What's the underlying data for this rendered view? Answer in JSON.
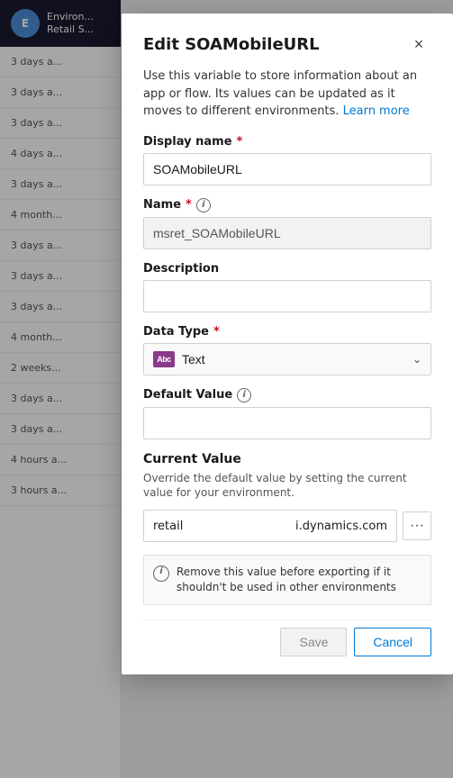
{
  "background": {
    "header": {
      "org_abbr": "E",
      "line1": "Environ...",
      "line2": "Retail S..."
    },
    "list_items": [
      {
        "age": "3 days a..."
      },
      {
        "age": "3 days a..."
      },
      {
        "age": "3 days a..."
      },
      {
        "age": "4 days a..."
      },
      {
        "age": "3 days a..."
      },
      {
        "age": "4 month..."
      },
      {
        "age": "3 days a..."
      },
      {
        "age": "3 days a..."
      },
      {
        "age": "3 days a..."
      },
      {
        "age": "4 month..."
      },
      {
        "age": "2 weeks..."
      },
      {
        "age": "3 days a..."
      },
      {
        "age": "3 days a..."
      },
      {
        "age": "4 hours a..."
      },
      {
        "age": "3 hours a..."
      }
    ]
  },
  "modal": {
    "title": "Edit SOAMobileURL",
    "close_label": "×",
    "description": "Use this variable to store information about an app or flow. Its values can be updated as it moves to different environments.",
    "learn_more": "Learn more",
    "display_name": {
      "label": "Display name",
      "required": true,
      "value": "SOAMobileURL"
    },
    "name": {
      "label": "Name",
      "required": true,
      "has_info": true,
      "value": "msret_SOAMobileURL",
      "readonly": true
    },
    "description_field": {
      "label": "Description",
      "value": "",
      "placeholder": ""
    },
    "data_type": {
      "label": "Data Type",
      "required": true,
      "type_icon_text": "Abc",
      "value": "Text"
    },
    "default_value": {
      "label": "Default Value",
      "has_info": true,
      "value": ""
    },
    "current_value": {
      "section_title": "Current Value",
      "section_desc": "Override the default value by setting the current value for your environment.",
      "value_left": "retail",
      "value_right": "i.dynamics.com",
      "ellipsis": "···"
    },
    "warning": {
      "text": "Remove this value before exporting if it shouldn't be used in other environments"
    },
    "footer": {
      "save_label": "Save",
      "cancel_label": "Cancel"
    }
  }
}
